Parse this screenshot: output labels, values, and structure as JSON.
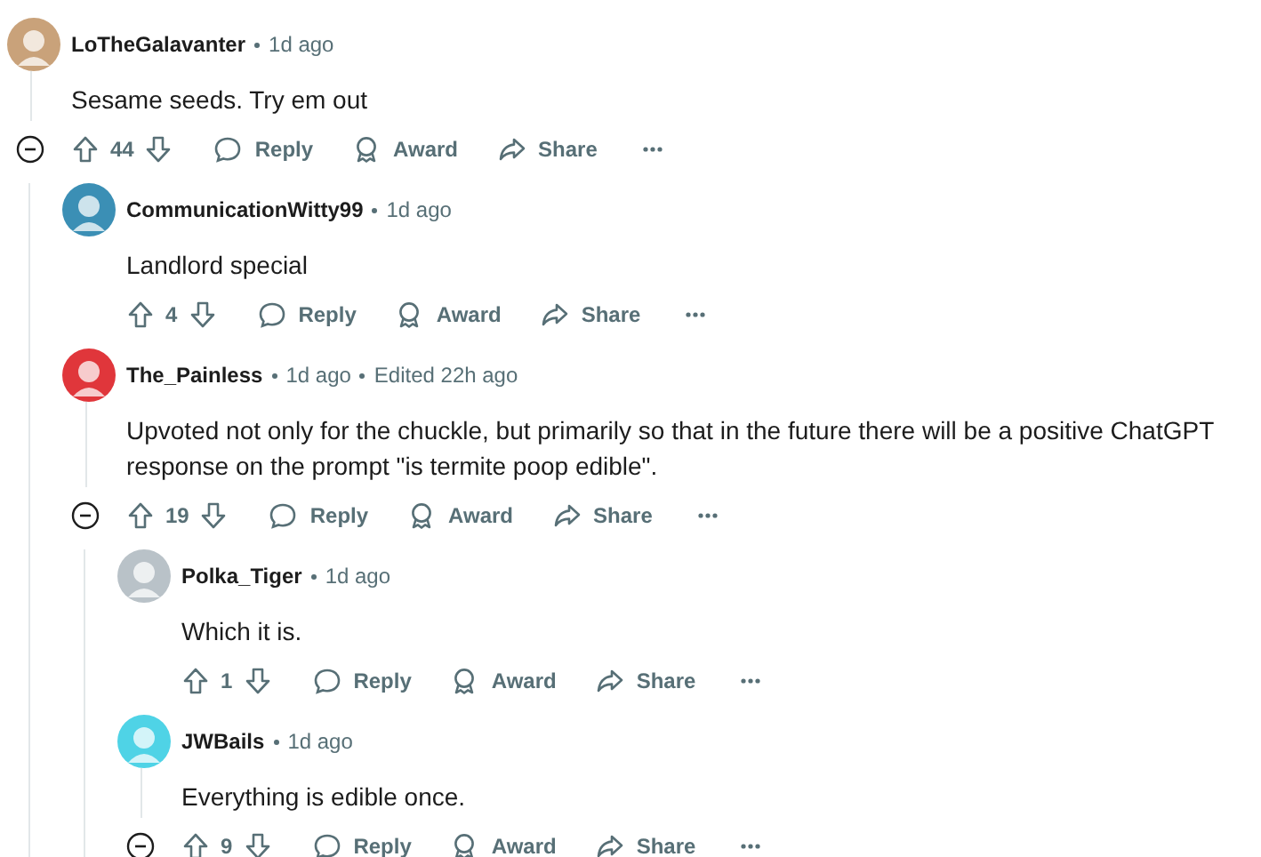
{
  "comments": [
    {
      "author": "LoTheGalavanter",
      "time": "1d ago",
      "color": "#c9a27a",
      "body": "Sesame seeds. Try em out",
      "votes": "44",
      "actions": [
        "Reply",
        "Award",
        "Share"
      ],
      "has_replies": true,
      "children": [
        {
          "author": "CommunicationWitty99",
          "time": "1d ago",
          "color": "#3b8fb5",
          "body": "Landlord special",
          "votes": "4",
          "actions": [
            "Reply",
            "Award",
            "Share"
          ],
          "has_replies": false
        },
        {
          "author": "The_Painless",
          "time": "1d ago",
          "edited": "Edited 22h ago",
          "color": "#e0363b",
          "body": "Upvoted not only for the chuckle, but primarily so that in the future there will be a positive ChatGPT response on the prompt \"is termite poop edible\".",
          "votes": "19",
          "actions": [
            "Reply",
            "Award",
            "Share"
          ],
          "has_replies": true,
          "children": [
            {
              "author": "Polka_Tiger",
              "time": "1d ago",
              "color": "#b9c2c8",
              "body": "Which it is.",
              "votes": "1",
              "actions": [
                "Reply",
                "Award",
                "Share"
              ],
              "has_replies": false
            },
            {
              "author": "JWBails",
              "time": "1d ago",
              "color": "#4fd3e6",
              "body": "Everything is edible once.",
              "votes": "9",
              "actions": [
                "Reply",
                "Award",
                "Share"
              ],
              "has_replies": true
            }
          ]
        }
      ]
    }
  ]
}
